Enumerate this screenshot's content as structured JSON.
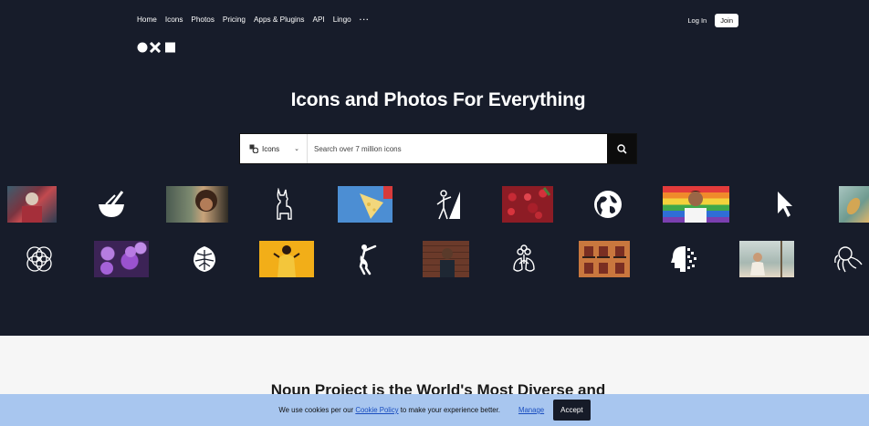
{
  "nav": {
    "items": [
      "Home",
      "Icons",
      "Photos",
      "Pricing",
      "Apps & Plugins",
      "API",
      "Lingo"
    ],
    "more_label": "···",
    "login_label": "Log In",
    "join_label": "Join"
  },
  "hero": {
    "headline": "Icons and Photos For Everything"
  },
  "search": {
    "type_label": "Icons",
    "placeholder": "Search over 7 million icons"
  },
  "gallery": {
    "row1": [
      {
        "kind": "photo",
        "icon": "person-portrait-photo"
      },
      {
        "kind": "icon",
        "icon": "mortar-pestle-icon"
      },
      {
        "kind": "photo",
        "icon": "curly-hair-woman-photo"
      },
      {
        "kind": "icon",
        "icon": "llama-icon"
      },
      {
        "kind": "photo",
        "icon": "cheese-board-photo"
      },
      {
        "kind": "icon",
        "icon": "climber-flag-icon"
      },
      {
        "kind": "photo",
        "icon": "cherries-photo"
      },
      {
        "kind": "icon",
        "icon": "globe-icon"
      },
      {
        "kind": "photo",
        "icon": "rainbow-flag-man-photo"
      },
      {
        "kind": "icon",
        "icon": "cursor-arrow-icon"
      },
      {
        "kind": "photo",
        "icon": "leaves-photo"
      }
    ],
    "row2": [
      {
        "kind": "icon",
        "icon": "interlocking-circles-icon"
      },
      {
        "kind": "photo",
        "icon": "purple-flowers-photo"
      },
      {
        "kind": "icon",
        "icon": "monstera-leaf-icon"
      },
      {
        "kind": "photo",
        "icon": "yellow-dress-woman-photo"
      },
      {
        "kind": "icon",
        "icon": "dancer-icon"
      },
      {
        "kind": "photo",
        "icon": "brick-wall-man-photo"
      },
      {
        "kind": "icon",
        "icon": "lungs-flower-icon"
      },
      {
        "kind": "photo",
        "icon": "balconies-building-photo"
      },
      {
        "kind": "icon",
        "icon": "pixel-head-icon"
      },
      {
        "kind": "photo",
        "icon": "woman-swing-photo"
      },
      {
        "kind": "icon",
        "icon": "octopus-icon"
      }
    ]
  },
  "section": {
    "heading": "Noun Project is the World's Most Diverse and"
  },
  "cookie": {
    "text_before": "We use cookies per our ",
    "policy_link": "Cookie Policy",
    "text_after": " to make your experience better.",
    "manage_label": "Manage",
    "accept_label": "Accept"
  },
  "colors": {
    "hero_bg": "#171c2a",
    "cookie_bg": "#a8c6ef",
    "link": "#1a4ebf"
  }
}
